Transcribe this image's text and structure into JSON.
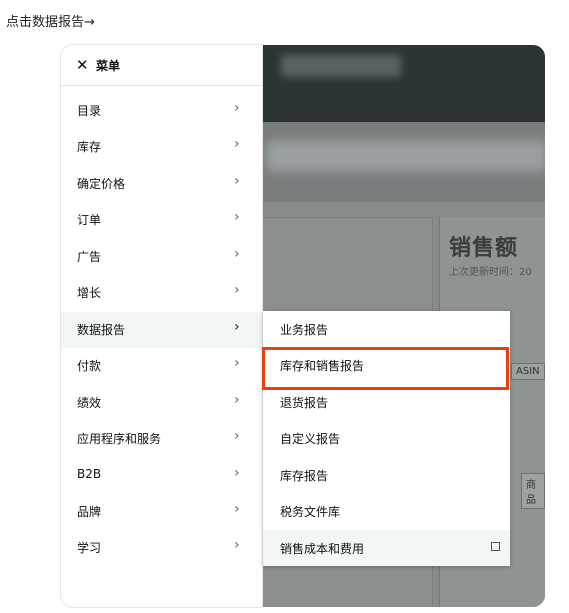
{
  "instruction": "点击数据报告→",
  "backdrop": {
    "sales_title": "销售额",
    "sales_subtitle": "上次更新时间：20",
    "chip_asin": "ASIN",
    "chip_product": "商品"
  },
  "menu": {
    "close_label": "✕",
    "title": "菜单",
    "items": [
      {
        "label": "目录"
      },
      {
        "label": "库存"
      },
      {
        "label": "确定价格"
      },
      {
        "label": "订单"
      },
      {
        "label": "广告"
      },
      {
        "label": "增长"
      },
      {
        "label": "数据报告"
      },
      {
        "label": "付款"
      },
      {
        "label": "绩效"
      },
      {
        "label": "应用程序和服务"
      },
      {
        "label": "B2B"
      },
      {
        "label": "品牌"
      },
      {
        "label": "学习"
      }
    ],
    "chevron": "›"
  },
  "submenu": {
    "items": [
      {
        "label": "业务报告"
      },
      {
        "label": "库存和销售报告"
      },
      {
        "label": "退货报告"
      },
      {
        "label": "自定义报告"
      },
      {
        "label": "库存报告"
      },
      {
        "label": "税务文件库"
      },
      {
        "label": "销售成本和费用"
      }
    ]
  },
  "colors": {
    "highlight": "#e8410d",
    "active_row": "#f1f5f5"
  }
}
